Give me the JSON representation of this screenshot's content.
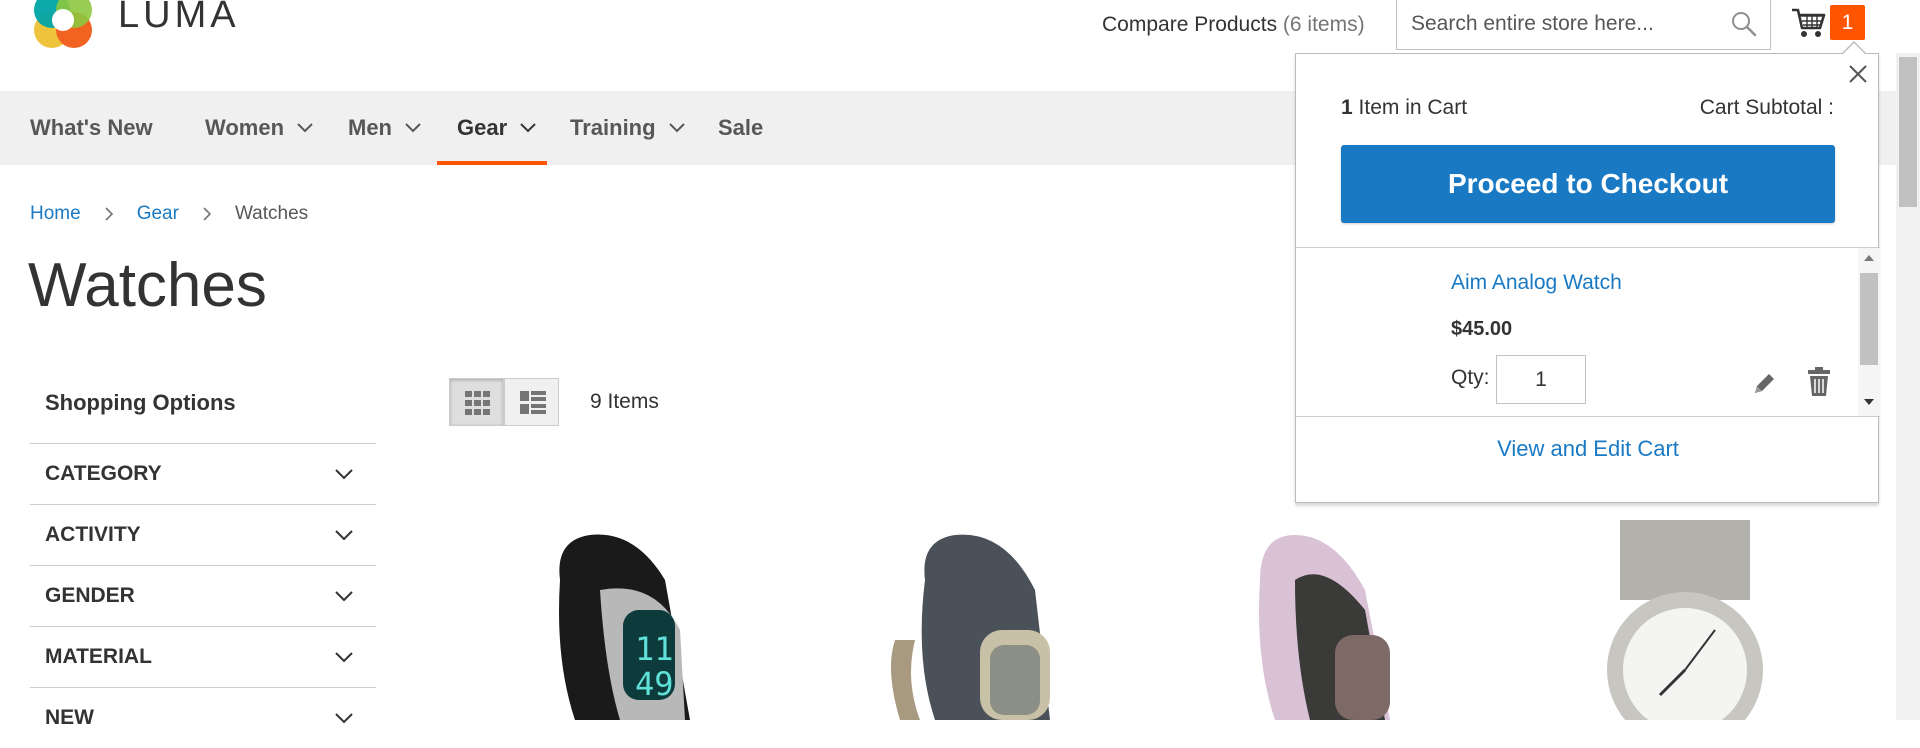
{
  "header": {
    "logo_text": "LUMA",
    "compare_label": "Compare Products",
    "compare_count": "(6 items)",
    "search_placeholder": "Search entire store here...",
    "cart_count": "1"
  },
  "nav": {
    "items": [
      {
        "label": "What's New",
        "dropdown": false
      },
      {
        "label": "Women",
        "dropdown": true
      },
      {
        "label": "Men",
        "dropdown": true
      },
      {
        "label": "Gear",
        "dropdown": true,
        "active": true
      },
      {
        "label": "Training",
        "dropdown": true
      },
      {
        "label": "Sale",
        "dropdown": false
      }
    ]
  },
  "breadcrumb": {
    "home": "Home",
    "gear": "Gear",
    "current": "Watches"
  },
  "page_title": "Watches",
  "sidebar": {
    "title": "Shopping Options",
    "filters": [
      "CATEGORY",
      "ACTIVITY",
      "GENDER",
      "MATERIAL",
      "NEW"
    ]
  },
  "toolbar": {
    "items_count": "9 Items"
  },
  "minicart": {
    "count": "1",
    "count_suffix": "Item in Cart",
    "subtotal_label": "Cart Subtotal :",
    "checkout_label": "Proceed to Checkout",
    "item": {
      "name": "Aim Analog Watch",
      "price": "$45.00",
      "qty_label": "Qty:",
      "qty": "1"
    },
    "view_edit_label": "View and Edit Cart"
  },
  "colors": {
    "accent": "#1979c3",
    "cart_badge": "#ff5501",
    "nav_active_underline": "#ff5501"
  }
}
